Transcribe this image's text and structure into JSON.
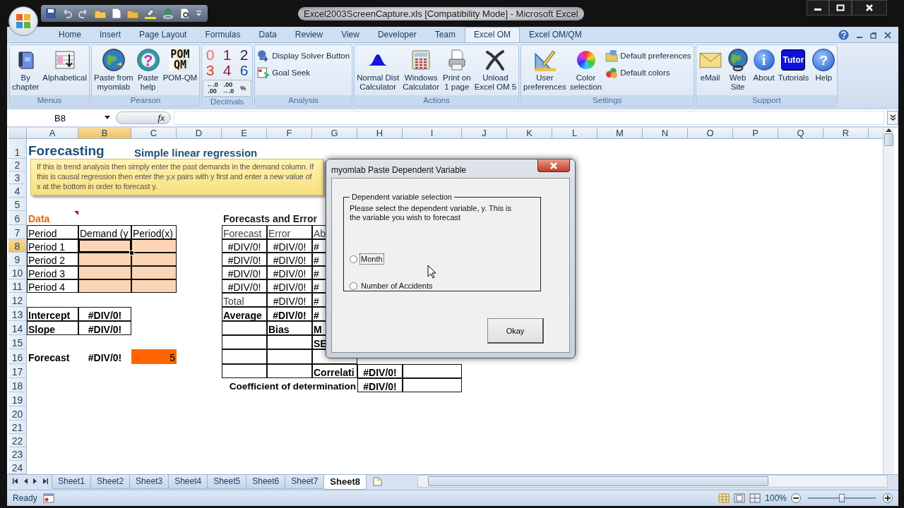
{
  "window": {
    "title": "Excel2003ScreenCapture.xls  [Compatibility Mode] - Microsoft Excel"
  },
  "ribbon_tabs": [
    {
      "label": "Home",
      "selected": false
    },
    {
      "label": "Insert",
      "selected": false
    },
    {
      "label": "Page Layout",
      "selected": false
    },
    {
      "label": "Formulas",
      "selected": false
    },
    {
      "label": "Data",
      "selected": false
    },
    {
      "label": "Review",
      "selected": false
    },
    {
      "label": "View",
      "selected": false
    },
    {
      "label": "Developer",
      "selected": false
    },
    {
      "label": "Team",
      "selected": false
    },
    {
      "label": "Excel OM",
      "selected": true
    },
    {
      "label": "Excel OM/QM",
      "selected": false
    }
  ],
  "ribbon_groups": [
    {
      "label": "Menus",
      "buttons": [
        {
          "kind": "large",
          "label": "By\nchapter"
        },
        {
          "kind": "large",
          "label": "Alphabetical"
        }
      ]
    },
    {
      "label": "Pearson",
      "buttons": [
        {
          "kind": "large",
          "label": "Paste from\nmyomlab"
        },
        {
          "kind": "large",
          "label": "Paste\nhelp",
          "icon_text": "?"
        },
        {
          "kind": "large",
          "label": "POM-QM",
          "icon_text": "POM\nQM"
        }
      ]
    },
    {
      "label": "Decimals",
      "buttons": [
        {
          "kind": "digit",
          "label": "0",
          "color": "#e8735a"
        },
        {
          "kind": "digit",
          "label": "1",
          "color": "#8e1b45"
        },
        {
          "kind": "digit",
          "label": "2",
          "color": "#3a1850"
        },
        {
          "kind": "digit",
          "label": "3",
          "color": "#d8442a"
        },
        {
          "kind": "digit",
          "label": "4",
          "color": "#8e1b45"
        },
        {
          "kind": "digit",
          "label": "6",
          "color": "#1c4f9e"
        },
        {
          "kind": "decimal",
          "label": "←.0\n.00"
        },
        {
          "kind": "decimal",
          "label": ".00\n→.0"
        },
        {
          "kind": "decimal",
          "label": "%"
        }
      ]
    },
    {
      "label": "Analysis",
      "buttons": [
        {
          "kind": "small",
          "label": "Display Solver Button"
        },
        {
          "kind": "small",
          "label": "Goal Seek"
        }
      ]
    },
    {
      "label": "Actions",
      "buttons": [
        {
          "kind": "large",
          "label": "Normal Dist\nCalculator"
        },
        {
          "kind": "large",
          "label": "Windows\nCalculator"
        },
        {
          "kind": "large",
          "label": "Print on\n1 page"
        },
        {
          "kind": "large",
          "label": "Unload\nExcel OM 5"
        }
      ]
    },
    {
      "label": "Settings",
      "buttons": [
        {
          "kind": "large",
          "label": "User\npreferences"
        },
        {
          "kind": "large",
          "label": "Color\nselection"
        },
        {
          "kind": "small",
          "label": "Default preferences"
        },
        {
          "kind": "small",
          "label": "Default colors"
        }
      ]
    },
    {
      "label": "Support",
      "buttons": [
        {
          "kind": "large",
          "label": "eMail"
        },
        {
          "kind": "large",
          "label": "Web\nSite"
        },
        {
          "kind": "large",
          "label": "About",
          "icon_text": "i"
        },
        {
          "kind": "large",
          "label": "Tutorials",
          "icon_text": "Tutor"
        },
        {
          "kind": "large",
          "label": "Help",
          "icon_text": "?"
        }
      ]
    }
  ],
  "formula_bar": {
    "name_box": "B8",
    "function_label": "fx"
  },
  "columns": [
    {
      "label": "A",
      "selected": false
    },
    {
      "label": "B",
      "selected": true
    },
    {
      "label": "C",
      "selected": false
    },
    {
      "label": "D",
      "selected": false
    },
    {
      "label": "E",
      "selected": false
    },
    {
      "label": "F",
      "selected": false
    },
    {
      "label": "G",
      "selected": false
    },
    {
      "label": "H",
      "selected": false
    },
    {
      "label": "I",
      "selected": false
    },
    {
      "label": "J",
      "selected": false
    },
    {
      "label": "K",
      "selected": false
    },
    {
      "label": "L",
      "selected": false
    },
    {
      "label": "M",
      "selected": false
    },
    {
      "label": "N",
      "selected": false
    },
    {
      "label": "O",
      "selected": false
    },
    {
      "label": "P",
      "selected": false
    },
    {
      "label": "Q",
      "selected": false
    },
    {
      "label": "R",
      "selected": false
    }
  ],
  "rows": [
    {
      "label": "1",
      "selected": false,
      "cells": [
        {
          "kind": "title",
          "text": "Forecasting"
        },
        null,
        {
          "kind": "heading",
          "text": "Simple linear regression"
        }
      ]
    },
    {
      "label": "2",
      "selected": false
    },
    {
      "label": "3",
      "selected": false
    },
    {
      "label": "4",
      "selected": false
    },
    {
      "label": "5",
      "selected": false
    },
    {
      "label": "6",
      "selected": false,
      "cells": [
        {
          "kind": "section",
          "text": "Data",
          "comment_marker": true
        },
        null,
        null,
        null,
        {
          "kind": "heading-dark",
          "text": "Forecasts and Error"
        }
      ]
    },
    {
      "label": "7",
      "selected": false,
      "cells": [
        {
          "kind": "cell",
          "text": "Period"
        },
        {
          "kind": "cell",
          "text": "Demand (y"
        },
        {
          "kind": "cell",
          "text": "Period(x)"
        },
        null,
        {
          "kind": "cell-muted",
          "text": "Forecast"
        },
        {
          "kind": "cell-muted",
          "text": "Error"
        },
        {
          "kind": "cell-muted",
          "text": "Ab"
        }
      ]
    },
    {
      "label": "8",
      "selected": true,
      "cells": [
        {
          "kind": "cell",
          "text": "Period 1"
        },
        {
          "kind": "input"
        },
        {
          "kind": "input"
        },
        null,
        {
          "kind": "value",
          "text": "#DIV/0!"
        },
        {
          "kind": "value",
          "text": "#DIV/0!"
        },
        {
          "kind": "cell",
          "text": "#"
        }
      ]
    },
    {
      "label": "9",
      "selected": false,
      "cells": [
        {
          "kind": "cell",
          "text": "Period 2"
        },
        {
          "kind": "input"
        },
        {
          "kind": "input"
        },
        null,
        {
          "kind": "value",
          "text": "#DIV/0!"
        },
        {
          "kind": "value",
          "text": "#DIV/0!"
        },
        {
          "kind": "cell",
          "text": "#"
        }
      ]
    },
    {
      "label": "10",
      "selected": false,
      "cells": [
        {
          "kind": "cell",
          "text": "Period 3"
        },
        {
          "kind": "input"
        },
        {
          "kind": "input"
        },
        null,
        {
          "kind": "value",
          "text": "#DIV/0!"
        },
        {
          "kind": "value",
          "text": "#DIV/0!"
        },
        {
          "kind": "cell",
          "text": "#"
        }
      ]
    },
    {
      "label": "11",
      "selected": false,
      "cells": [
        {
          "kind": "cell",
          "text": "Period 4"
        },
        {
          "kind": "input"
        },
        {
          "kind": "input"
        },
        null,
        {
          "kind": "value",
          "text": "#DIV/0!"
        },
        {
          "kind": "value",
          "text": "#DIV/0!"
        },
        {
          "kind": "cell",
          "text": "#"
        }
      ]
    },
    {
      "label": "12",
      "selected": false,
      "cells": [
        null,
        null,
        null,
        null,
        {
          "kind": "cell-muted",
          "text": "Total"
        },
        {
          "kind": "value",
          "text": "#DIV/0!"
        },
        {
          "kind": "cell",
          "text": "#"
        }
      ]
    },
    {
      "label": "13",
      "selected": false,
      "cells": [
        {
          "kind": "strong",
          "text": "Intercept"
        },
        {
          "kind": "strong-value",
          "text": "#DIV/0!"
        },
        null,
        null,
        {
          "kind": "strong",
          "text": "Average"
        },
        {
          "kind": "strong-value",
          "text": "#DIV/0!"
        },
        {
          "kind": "strong",
          "text": "#"
        }
      ]
    },
    {
      "label": "14",
      "selected": false,
      "cells": [
        {
          "kind": "strong",
          "text": "Slope"
        },
        {
          "kind": "strong-value",
          "text": "#DIV/0!"
        },
        null,
        null,
        {
          "kind": "cell"
        },
        {
          "kind": "strong",
          "text": "Bias"
        },
        {
          "kind": "strong",
          "text": "M"
        }
      ]
    },
    {
      "label": "15",
      "selected": false,
      "cells": [
        null,
        null,
        null,
        null,
        {
          "kind": "cell"
        },
        {
          "kind": "cell"
        },
        {
          "kind": "strong",
          "text": "SE"
        }
      ]
    },
    {
      "label": "16",
      "selected": false,
      "cells": [
        {
          "kind": "bold",
          "text": "Forecast"
        },
        {
          "kind": "bold-center",
          "text": "#DIV/0!"
        },
        {
          "kind": "accent",
          "text": "5"
        },
        null,
        {
          "kind": "cell"
        },
        {
          "kind": "cell"
        },
        {
          "kind": "cell"
        }
      ]
    },
    {
      "label": "17",
      "selected": false,
      "cells": [
        null,
        null,
        null,
        null,
        {
          "kind": "cell"
        },
        {
          "kind": "cell"
        },
        {
          "kind": "strong",
          "text": "Correlati"
        },
        {
          "kind": "strong-value",
          "text": "#DIV/0!"
        },
        {
          "kind": "cell"
        }
      ]
    },
    {
      "label": "18",
      "selected": false,
      "cells": [
        null,
        null,
        null,
        null,
        null,
        null,
        {
          "kind": "bold-right",
          "text": "Coefficient of determination"
        },
        {
          "kind": "strong-value",
          "text": "#DIV/0!"
        },
        {
          "kind": "cell"
        }
      ]
    },
    {
      "label": "19",
      "selected": false
    },
    {
      "label": "20",
      "selected": false
    },
    {
      "label": "21",
      "selected": false
    },
    {
      "label": "22",
      "selected": false
    },
    {
      "label": "23",
      "selected": false
    },
    {
      "label": "24",
      "selected": false
    }
  ],
  "comment_note": "If this is trend analysis then simply enter the past demands in the demand column. If this is causal regression then enter the y,x pairs with y first and enter a new value of x at the bottom in order to forecast y.",
  "dialog": {
    "title": "myomlab Paste Dependent Variable",
    "group_label": "Dependent variable selection",
    "instructions": "Please select the dependent variable, y. This is the variable you wish to forecast",
    "options": [
      {
        "label": "Month",
        "selected": false,
        "focused": true
      },
      {
        "label": "Number of Accidents",
        "selected": false,
        "focused": false
      }
    ],
    "ok_button": "Okay"
  },
  "sheet_tabs": [
    {
      "label": "Sheet1",
      "selected": false
    },
    {
      "label": "Sheet2",
      "selected": false
    },
    {
      "label": "Sheet3",
      "selected": false
    },
    {
      "label": "Sheet4",
      "selected": false
    },
    {
      "label": "Sheet5",
      "selected": false
    },
    {
      "label": "Sheet6",
      "selected": false
    },
    {
      "label": "Sheet7",
      "selected": false
    },
    {
      "label": "Sheet8",
      "selected": true
    }
  ],
  "status_bar": {
    "text": "Ready",
    "zoom": "100%",
    "zoom_slider": {
      "level": 0.5
    }
  }
}
